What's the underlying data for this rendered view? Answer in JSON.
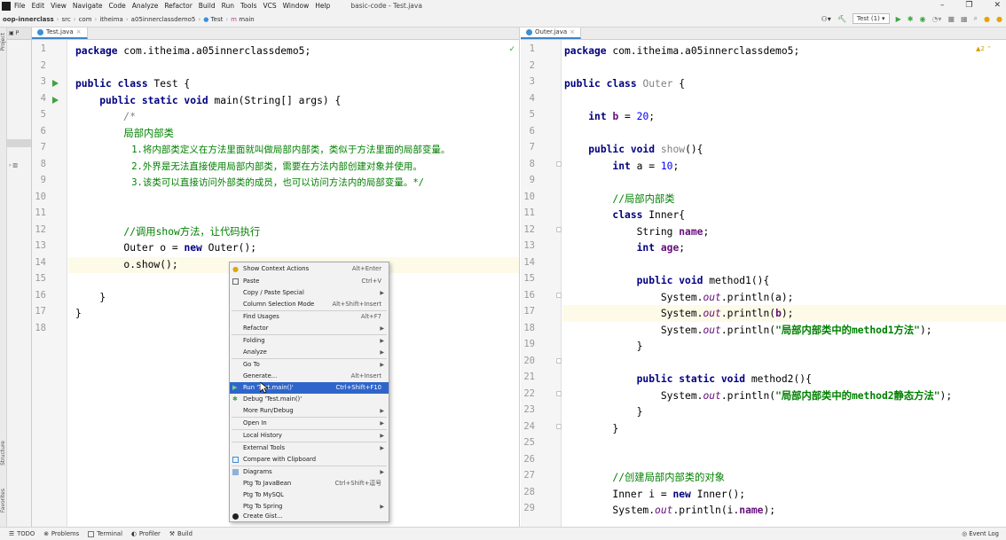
{
  "menu": {
    "items": [
      "File",
      "Edit",
      "View",
      "Navigate",
      "Code",
      "Analyze",
      "Refactor",
      "Build",
      "Run",
      "Tools",
      "VCS",
      "Window",
      "Help"
    ],
    "window_title": "basic-code - Test.java"
  },
  "breadcrumb": {
    "items": [
      "oop-innerclass",
      "src",
      "com",
      "itheima",
      "a05innerclassdemo5",
      "Test",
      "main"
    ]
  },
  "run_config": "Test (1)",
  "left_editor": {
    "tab": "Test.java",
    "lines": [
      "1",
      "2",
      "3",
      "4",
      "5",
      "6",
      "7",
      "8",
      "9",
      "10",
      "11",
      "12",
      "13",
      "14",
      "15",
      "16",
      "17",
      "18"
    ]
  },
  "right_editor": {
    "tab": "Outer.java",
    "warnings": "2",
    "lines": [
      "1",
      "2",
      "3",
      "4",
      "5",
      "6",
      "7",
      "8",
      "9",
      "10",
      "11",
      "12",
      "13",
      "14",
      "15",
      "16",
      "17",
      "18",
      "19",
      "20",
      "21",
      "22",
      "23",
      "24",
      "25",
      "26",
      "27",
      "28",
      "29"
    ]
  },
  "context_menu": [
    {
      "label": "Show Context Actions",
      "shortcut": "Alt+Enter",
      "icon": "bulb-icon"
    },
    {
      "label": "Paste",
      "shortcut": "Ctrl+V",
      "icon": "paste-icon"
    },
    {
      "label": "Copy / Paste Special",
      "submenu": true
    },
    {
      "label": "Column Selection Mode",
      "shortcut": "Alt+Shift+Insert"
    },
    {
      "label": "Find Usages",
      "shortcut": "Alt+F7"
    },
    {
      "label": "Refactor",
      "submenu": true
    },
    {
      "label": "Folding",
      "submenu": true
    },
    {
      "label": "Analyze",
      "submenu": true
    },
    {
      "label": "Go To",
      "submenu": true
    },
    {
      "label": "Generate...",
      "shortcut": "Alt+Insert"
    },
    {
      "label": "Run 'Test.main()'",
      "shortcut": "Ctrl+Shift+F10",
      "icon": "run-icon",
      "selected": true
    },
    {
      "label": "Debug 'Test.main()'",
      "icon": "debug-icon"
    },
    {
      "label": "More Run/Debug",
      "submenu": true
    },
    {
      "label": "Open In",
      "submenu": true
    },
    {
      "label": "Local History",
      "submenu": true
    },
    {
      "label": "External Tools",
      "submenu": true
    },
    {
      "label": "Compare with Clipboard",
      "icon": "compare-icon"
    },
    {
      "label": "Diagrams",
      "submenu": true,
      "icon": "diagram-icon"
    },
    {
      "label": "Ptg To JavaBean",
      "shortcut": "Ctrl+Shift+逗号"
    },
    {
      "label": "Ptg To MySQL"
    },
    {
      "label": "Ptg To Spring",
      "submenu": true
    },
    {
      "label": "Create Gist...",
      "icon": "github-icon"
    }
  ],
  "bottom_tools": [
    "TODO",
    "Problems",
    "Terminal",
    "Profiler",
    "Build"
  ],
  "event_log": "Event Log",
  "side_labels": {
    "project": "Project",
    "structure": "Structure",
    "favorites": "Favorites"
  }
}
